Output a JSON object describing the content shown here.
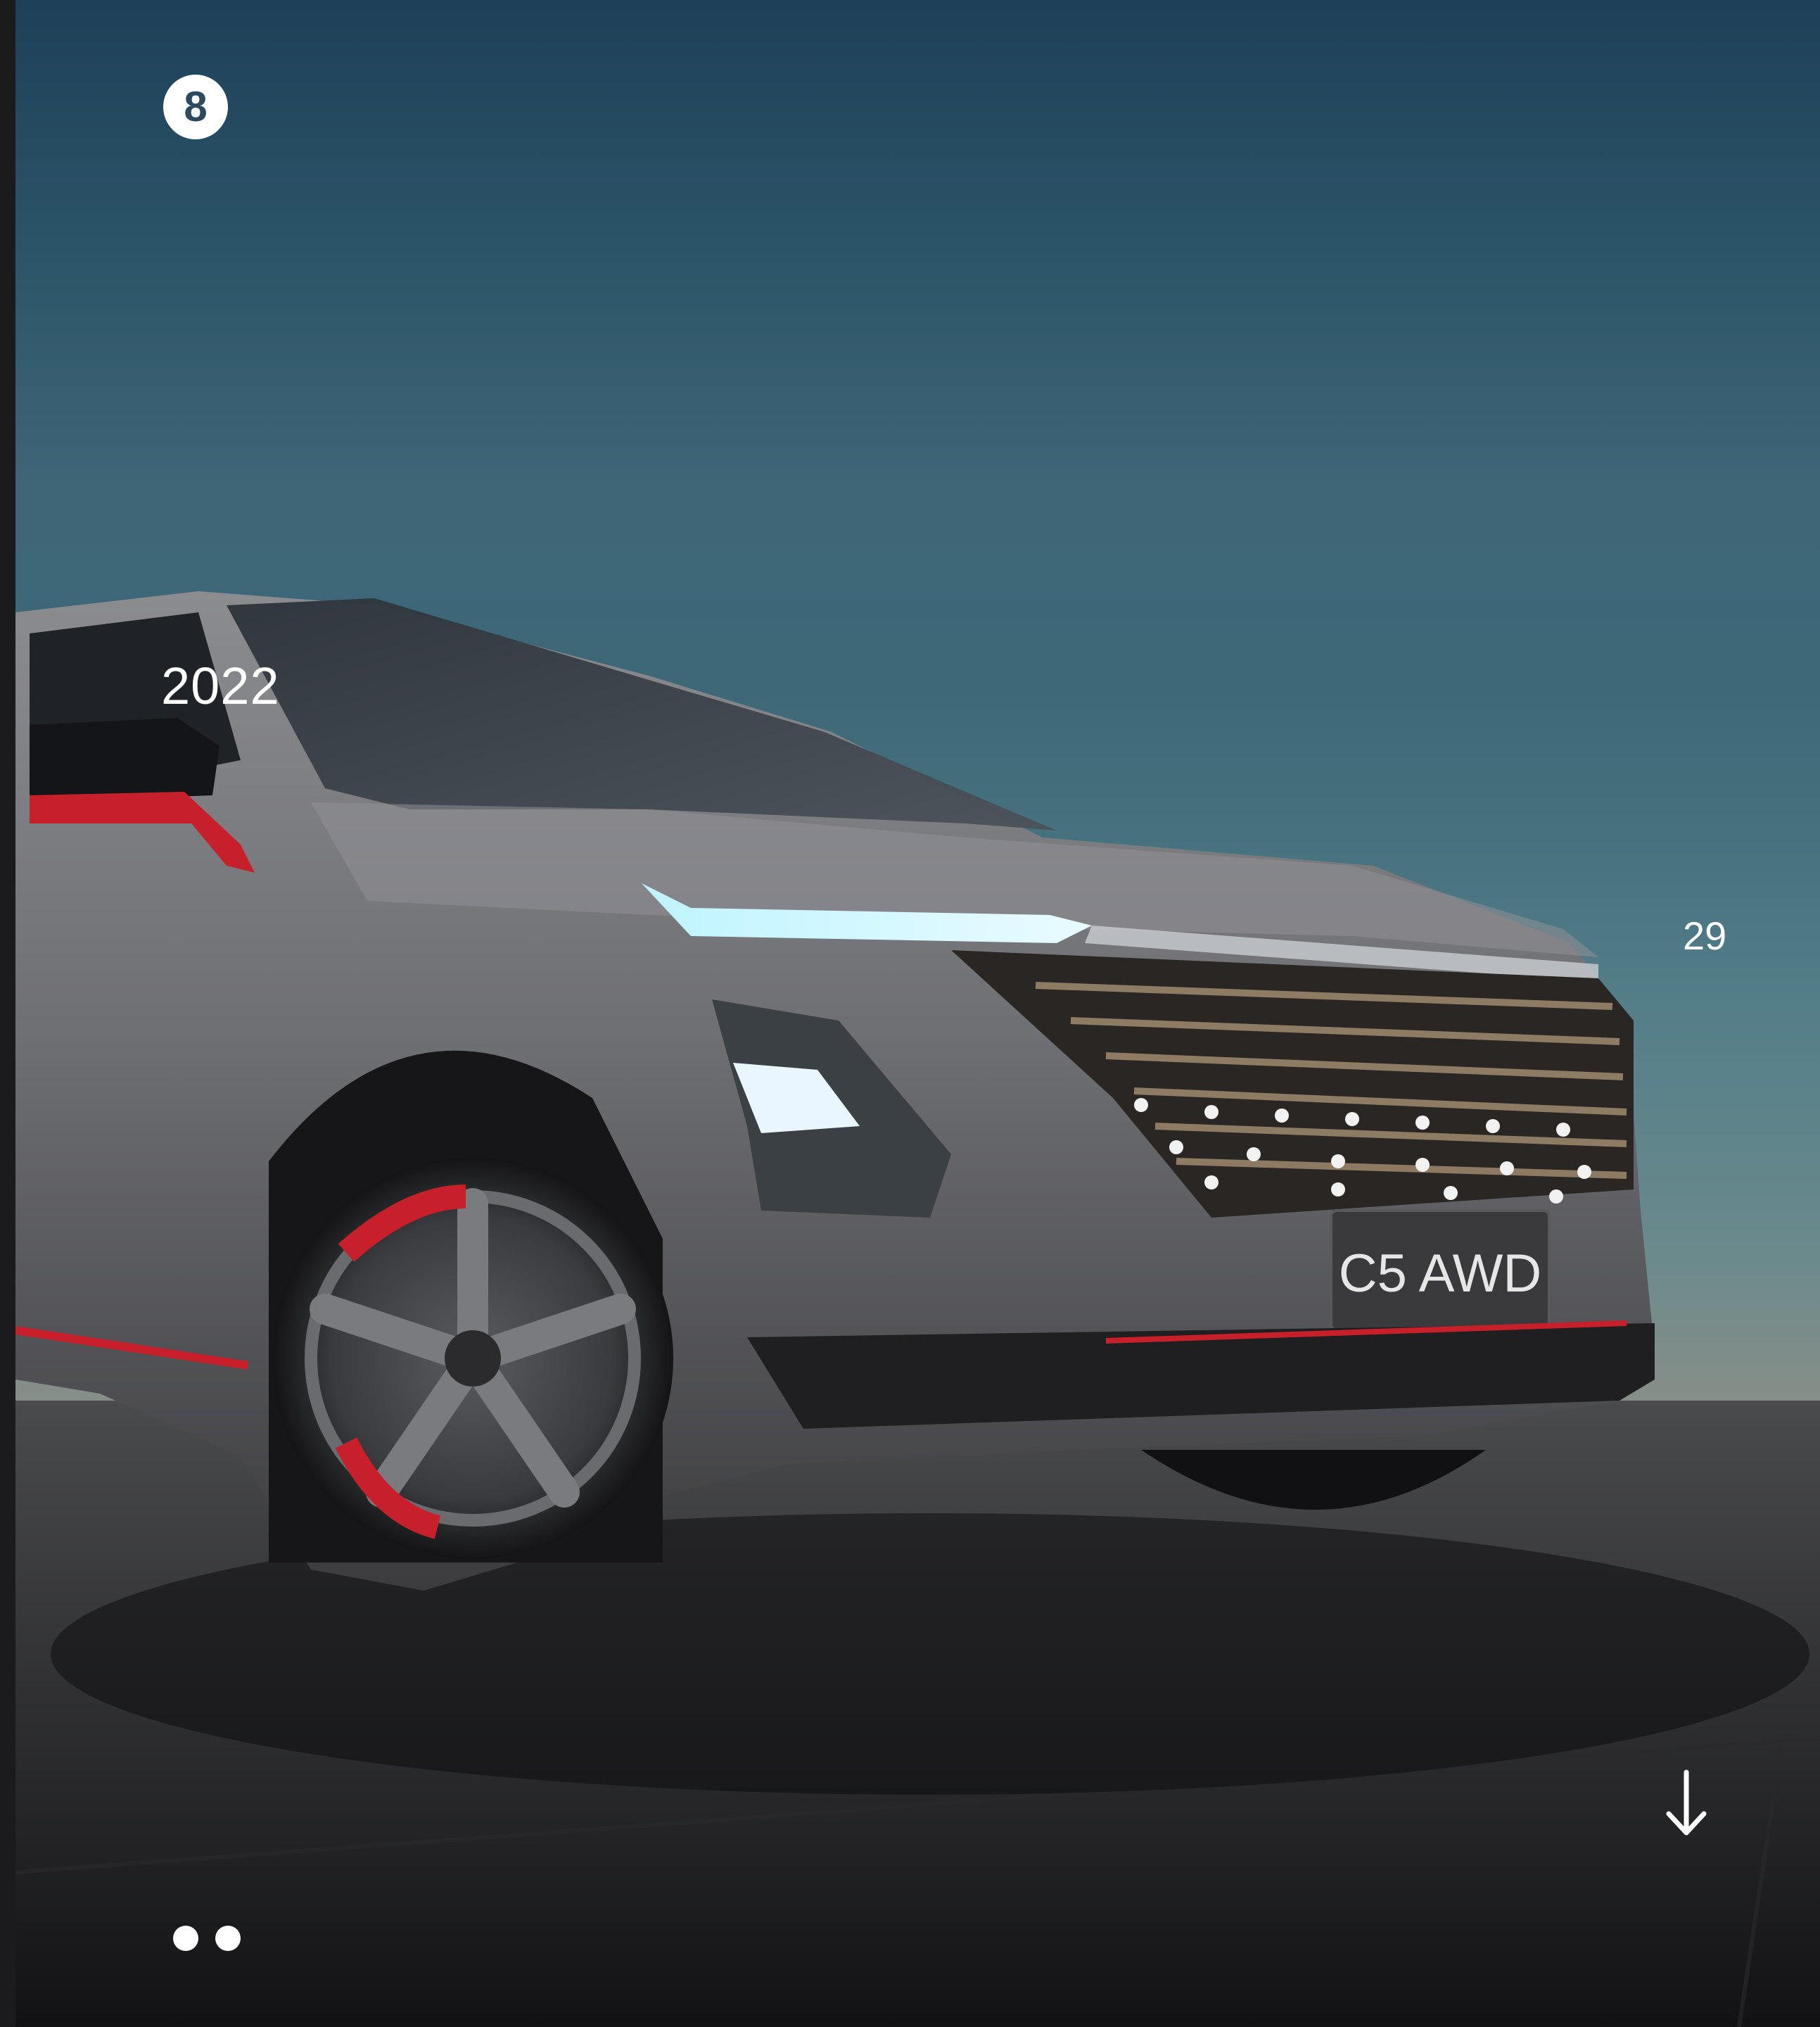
{
  "brand": {
    "badge_text": "8"
  },
  "year": {
    "label": "2022"
  },
  "date": {
    "day": "29"
  },
  "vehicle": {
    "plate_text": "C5 AWD"
  },
  "pager": {
    "count": 2
  },
  "icons": {
    "scroll": "arrow-down-icon",
    "badge": "brand-badge-icon"
  },
  "colors": {
    "text": "#ffffff",
    "accent_red": "#c8202a",
    "sky_top": "#1e4058",
    "ground": "#161618"
  }
}
